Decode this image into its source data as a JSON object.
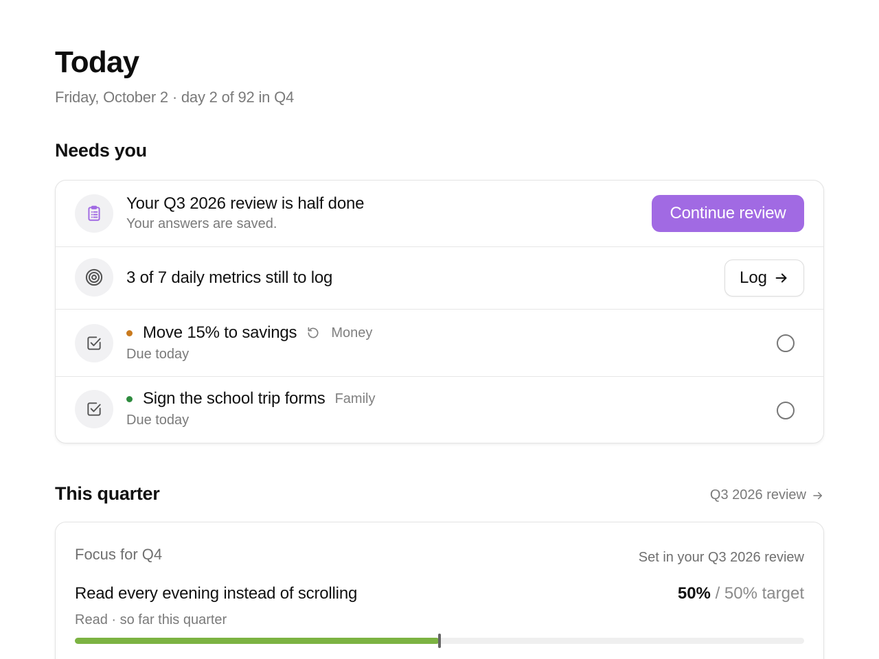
{
  "header": {
    "title": "Today",
    "subtitle": "Friday, October 2 · day 2 of 92 in Q4"
  },
  "needs_you": {
    "title": "Needs you",
    "review": {
      "title": "Your Q3 2026 review is half done",
      "subtitle": "Your answers are saved.",
      "button": "Continue review",
      "icon": "clipboard-icon"
    },
    "metrics": {
      "title": "3 of 7 daily metrics still to log",
      "button": "Log",
      "icon": "target-icon"
    },
    "tasks": [
      {
        "name": "Move 15% to savings",
        "tag": "Money",
        "repeating": true,
        "due": "Due today",
        "dot_color": "#c97a1e",
        "icon": "checkbox-icon"
      },
      {
        "name": "Sign the school trip forms",
        "tag": "Family",
        "repeating": false,
        "due": "Due today",
        "dot_color": "#2e8b3e",
        "icon": "checkbox-icon"
      }
    ]
  },
  "this_quarter": {
    "title": "This quarter",
    "link": "Q3 2026 review",
    "focus": {
      "label": "Focus for Q4",
      "meta": "Set in your Q3 2026 review",
      "goal": "Read every evening instead of scrolling",
      "value": "50%",
      "target": "/ 50% target",
      "subtitle": "Read · so far this quarter",
      "progress": 0.5,
      "target_fraction": 0.5
    }
  },
  "colors": {
    "accent": "#a16ae3",
    "progress": "#7cb342"
  }
}
